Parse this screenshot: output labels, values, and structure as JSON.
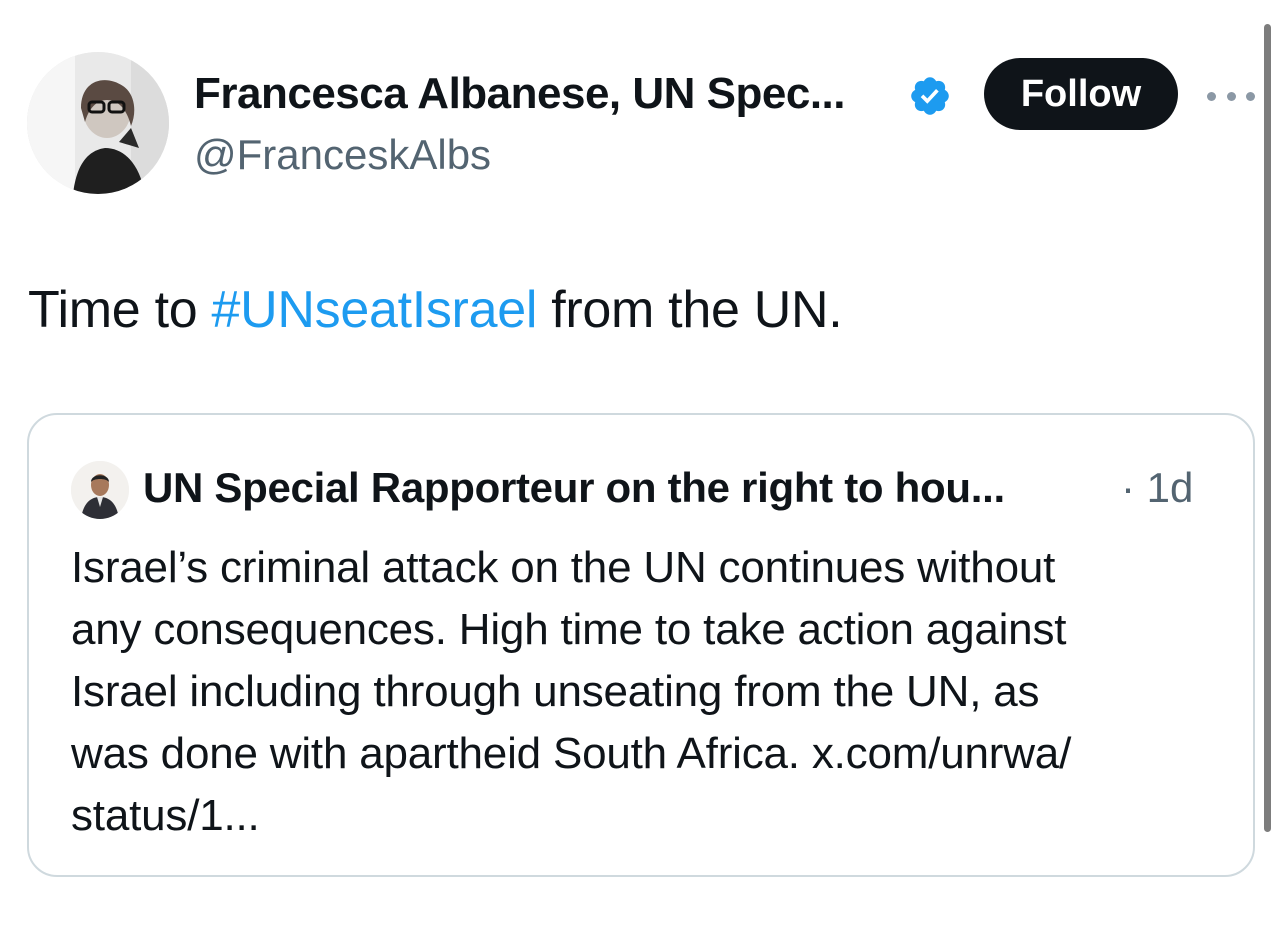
{
  "tweet": {
    "author_name": "Francesca Albanese, UN Spec...",
    "handle": "@FranceskAlbs",
    "follow_label": "Follow",
    "text_before": "Time to ",
    "hashtag": "#UNseatIsrael",
    "text_after": " from the UN."
  },
  "quote": {
    "author_name": "UN Special Rapporteur on the right to hou...",
    "time": "· 1d",
    "lines": [
      "Israel’s criminal attack on the UN continues without",
      "any consequences. High time to take action against",
      "Israel including through unseating from the UN, as",
      "was done with apartheid South Africa. x.com/unrwa/",
      "status/1..."
    ]
  },
  "colors": {
    "accent": "#1d9bf0",
    "text": "#0f1419",
    "secondary": "#536471",
    "border": "#cfd9de",
    "follow_bg": "#0f1419"
  },
  "icons": {
    "verified": "verified-badge-icon",
    "more": "more-horizontal-icon"
  }
}
